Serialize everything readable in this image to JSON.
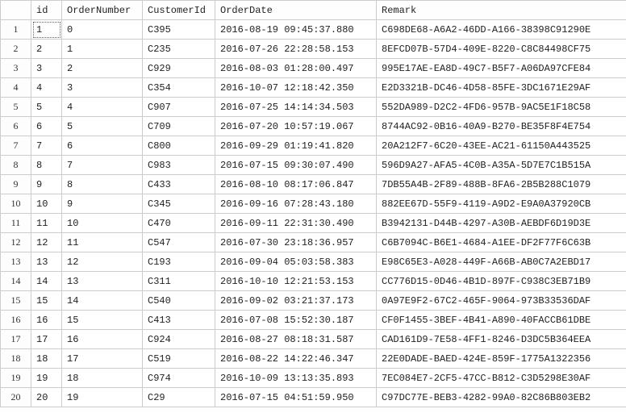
{
  "columns": [
    "",
    "id",
    "OrderNumber",
    "CustomerId",
    "OrderDate",
    "Remark"
  ],
  "selected": {
    "row": 0,
    "col": 1
  },
  "rows": [
    {
      "n": "1",
      "id": "1",
      "OrderNumber": "0",
      "CustomerId": "C395",
      "OrderDate": "2016-08-19 09:45:37.880",
      "Remark": "C698DE68-A6A2-46DD-A166-38398C91290E"
    },
    {
      "n": "2",
      "id": "2",
      "OrderNumber": "1",
      "CustomerId": "C235",
      "OrderDate": "2016-07-26 22:28:58.153",
      "Remark": "8EFCD07B-57D4-409E-8220-C8C84498CF75"
    },
    {
      "n": "3",
      "id": "3",
      "OrderNumber": "2",
      "CustomerId": "C929",
      "OrderDate": "2016-08-03 01:28:00.497",
      "Remark": "995E17AE-EA8D-49C7-B5F7-A06DA97CFE84"
    },
    {
      "n": "4",
      "id": "4",
      "OrderNumber": "3",
      "CustomerId": "C354",
      "OrderDate": "2016-10-07 12:18:42.350",
      "Remark": "E2D3321B-DC46-4D58-85FE-3DC1671E29AF"
    },
    {
      "n": "5",
      "id": "5",
      "OrderNumber": "4",
      "CustomerId": "C907",
      "OrderDate": "2016-07-25 14:14:34.503",
      "Remark": "552DA989-D2C2-4FD6-957B-9AC5E1F18C58"
    },
    {
      "n": "6",
      "id": "6",
      "OrderNumber": "5",
      "CustomerId": "C709",
      "OrderDate": "2016-07-20 10:57:19.067",
      "Remark": "8744AC92-0B16-40A9-B270-BE35F8F4E754"
    },
    {
      "n": "7",
      "id": "7",
      "OrderNumber": "6",
      "CustomerId": "C800",
      "OrderDate": "2016-09-29 01:19:41.820",
      "Remark": "20A212F7-6C20-43EE-AC21-61150A443525"
    },
    {
      "n": "8",
      "id": "8",
      "OrderNumber": "7",
      "CustomerId": "C983",
      "OrderDate": "2016-07-15 09:30:07.490",
      "Remark": "596D9A27-AFA5-4C0B-A35A-5D7E7C1B515A"
    },
    {
      "n": "9",
      "id": "9",
      "OrderNumber": "8",
      "CustomerId": "C433",
      "OrderDate": "2016-08-10 08:17:06.847",
      "Remark": "7DB55A4B-2F89-488B-8FA6-2B5B288C1079"
    },
    {
      "n": "10",
      "id": "10",
      "OrderNumber": "9",
      "CustomerId": "C345",
      "OrderDate": "2016-09-16 07:28:43.180",
      "Remark": "882EE67D-55F9-4119-A9D2-E9A0A37920CB"
    },
    {
      "n": "11",
      "id": "11",
      "OrderNumber": "10",
      "CustomerId": "C470",
      "OrderDate": "2016-09-11 22:31:30.490",
      "Remark": "B3942131-D44B-4297-A30B-AEBDF6D19D3E"
    },
    {
      "n": "12",
      "id": "12",
      "OrderNumber": "11",
      "CustomerId": "C547",
      "OrderDate": "2016-07-30 23:18:36.957",
      "Remark": "C6B7094C-B6E1-4684-A1EE-DF2F77F6C63B"
    },
    {
      "n": "13",
      "id": "13",
      "OrderNumber": "12",
      "CustomerId": "C193",
      "OrderDate": "2016-09-04 05:03:58.383",
      "Remark": "E98C65E3-A028-449F-A66B-AB0C7A2EBD17"
    },
    {
      "n": "14",
      "id": "14",
      "OrderNumber": "13",
      "CustomerId": "C311",
      "OrderDate": "2016-10-10 12:21:53.153",
      "Remark": "CC776D15-0D46-4B1D-897F-C938C3EB71B9"
    },
    {
      "n": "15",
      "id": "15",
      "OrderNumber": "14",
      "CustomerId": "C540",
      "OrderDate": "2016-09-02 03:21:37.173",
      "Remark": "0A97E9F2-67C2-465F-9064-973B33536DAF"
    },
    {
      "n": "16",
      "id": "16",
      "OrderNumber": "15",
      "CustomerId": "C413",
      "OrderDate": "2016-07-08 15:52:30.187",
      "Remark": "CF0F1455-3BEF-4B41-A890-40FACCB61DBE"
    },
    {
      "n": "17",
      "id": "17",
      "OrderNumber": "16",
      "CustomerId": "C924",
      "OrderDate": "2016-08-27 08:18:31.587",
      "Remark": "CAD161D9-7E58-4FF1-8246-D3DC5B364EEA"
    },
    {
      "n": "18",
      "id": "18",
      "OrderNumber": "17",
      "CustomerId": "C519",
      "OrderDate": "2016-08-22 14:22:46.347",
      "Remark": "22E0DADE-BAED-424E-859F-1775A1322356"
    },
    {
      "n": "19",
      "id": "19",
      "OrderNumber": "18",
      "CustomerId": "C974",
      "OrderDate": "2016-10-09 13:13:35.893",
      "Remark": "7EC084E7-2CF5-47CC-B812-C3D5298E30AF"
    },
    {
      "n": "20",
      "id": "20",
      "OrderNumber": "19",
      "CustomerId": "C29",
      "OrderDate": "2016-07-15 04:51:59.950",
      "Remark": "C97DC77E-BEB3-4282-99A0-82C86B803EB2"
    }
  ]
}
